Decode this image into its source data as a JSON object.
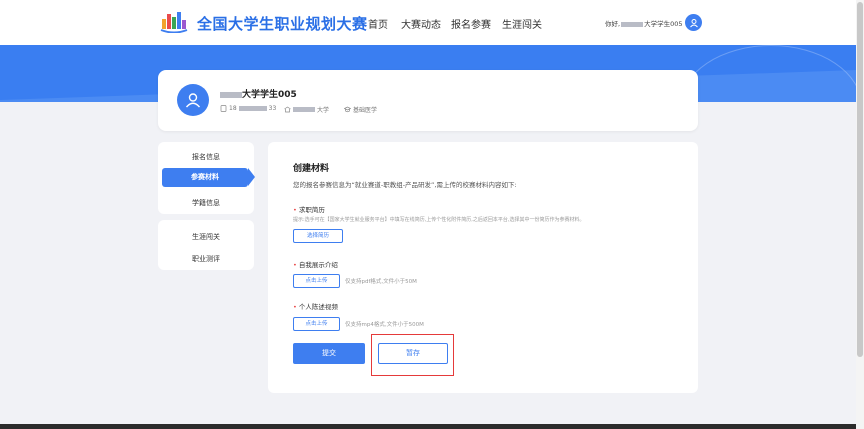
{
  "header": {
    "logo_text": "全国大学生职业规划大赛",
    "nav": [
      "首页",
      "大赛动态",
      "报名参赛",
      "生涯闯关"
    ],
    "greeting_prefix": "你好,",
    "greeting_suffix": "大学学生005",
    "avatar_icon": "user-icon"
  },
  "profile": {
    "name_suffix": "大学学生005",
    "phone_prefix": "18",
    "phone_suffix": "33",
    "school_suffix": "大学",
    "major": "基础医学",
    "avatar_icon": "user-icon"
  },
  "sidebar": {
    "group1": [
      "报名信息",
      "参赛材料",
      "学籍信息"
    ],
    "active_index": 1,
    "group2": [
      "生涯闯关",
      "职业测评"
    ]
  },
  "form": {
    "title": "创建材料",
    "intro": "您的报名参赛信息为“就业赛道-职教组-产品研发”,需上传的校赛材料内容如下:",
    "resume": {
      "label": "求职简历",
      "hint": "提示:选手可在【国家大学生就业服务平台】中填写在线简历,上传个性化附件简历,之后返回本平台,选择其中一份简历作为参赛材料。",
      "button": "选择简历"
    },
    "intro_doc": {
      "label": "自我展示介绍",
      "button": "点击上传",
      "tip": "仅支持pdf格式,文件小于50M"
    },
    "video": {
      "label": "个人陈述视频",
      "button": "点击上传",
      "tip": "仅支持mp4格式,文件小于500M"
    },
    "submit": "提交",
    "save": "暂存"
  },
  "colors": {
    "primary": "#3e7ef0",
    "highlight": "#e53a3a"
  }
}
